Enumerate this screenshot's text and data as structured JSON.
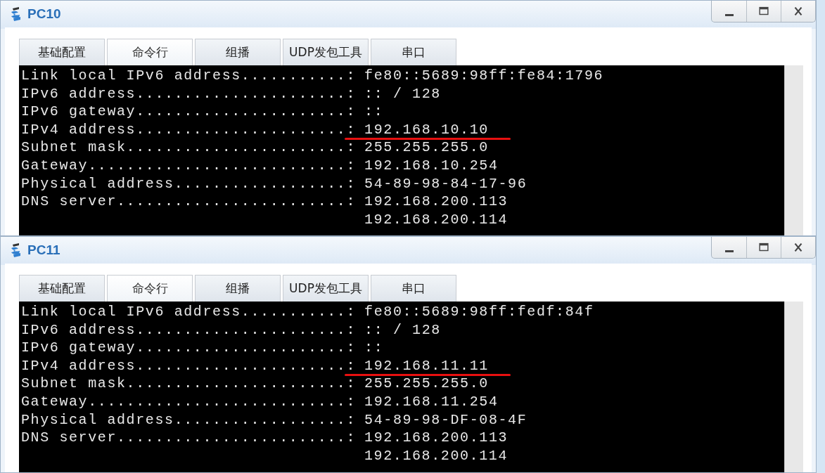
{
  "windows": [
    {
      "title": "PC10",
      "tabs": [
        {
          "label": "基础配置",
          "selected": false
        },
        {
          "label": "命令行",
          "selected": true
        },
        {
          "label": "组播",
          "selected": false
        },
        {
          "label": "UDP发包工具",
          "selected": false
        },
        {
          "label": "串口",
          "selected": false
        }
      ],
      "lines": [
        {
          "label": "Link local IPv6 address...........:",
          "value": "fe80::5689:98ff:fe84:1796",
          "underlined": false
        },
        {
          "label": "IPv6 address......................:",
          "value": ":: / 128",
          "underlined": false
        },
        {
          "label": "IPv6 gateway......................:",
          "value": "::",
          "underlined": false
        },
        {
          "label": "IPv4 address......................:",
          "value": "192.168.10.10",
          "underlined": true
        },
        {
          "label": "Subnet mask.......................:",
          "value": "255.255.255.0",
          "underlined": false
        },
        {
          "label": "Gateway...........................:",
          "value": "192.168.10.254",
          "underlined": false
        },
        {
          "label": "Physical address..................:",
          "value": "54-89-98-84-17-96",
          "underlined": false
        },
        {
          "label": "DNS server........................:",
          "value": "192.168.200.113",
          "underlined": false
        },
        {
          "value": "192.168.200.114",
          "underlined": false
        }
      ]
    },
    {
      "title": "PC11",
      "tabs": [
        {
          "label": "基础配置",
          "selected": false
        },
        {
          "label": "命令行",
          "selected": true
        },
        {
          "label": "组播",
          "selected": false
        },
        {
          "label": "UDP发包工具",
          "selected": false
        },
        {
          "label": "串口",
          "selected": false
        }
      ],
      "lines": [
        {
          "label": "Link local IPv6 address...........:",
          "value": "fe80::5689:98ff:fedf:84f",
          "underlined": false
        },
        {
          "label": "IPv6 address......................:",
          "value": ":: / 128",
          "underlined": false
        },
        {
          "label": "IPv6 gateway......................:",
          "value": "::",
          "underlined": false
        },
        {
          "label": "IPv4 address......................:",
          "value": "192.168.11.11",
          "underlined": true
        },
        {
          "label": "Subnet mask.......................:",
          "value": "255.255.255.0",
          "underlined": false
        },
        {
          "label": "Gateway...........................:",
          "value": "192.168.11.254",
          "underlined": false
        },
        {
          "label": "Physical address..................:",
          "value": "54-89-98-DF-08-4F",
          "underlined": false
        },
        {
          "label": "DNS server........................:",
          "value": "192.168.200.113",
          "underlined": false
        },
        {
          "value": "192.168.200.114",
          "underlined": false
        }
      ]
    }
  ]
}
